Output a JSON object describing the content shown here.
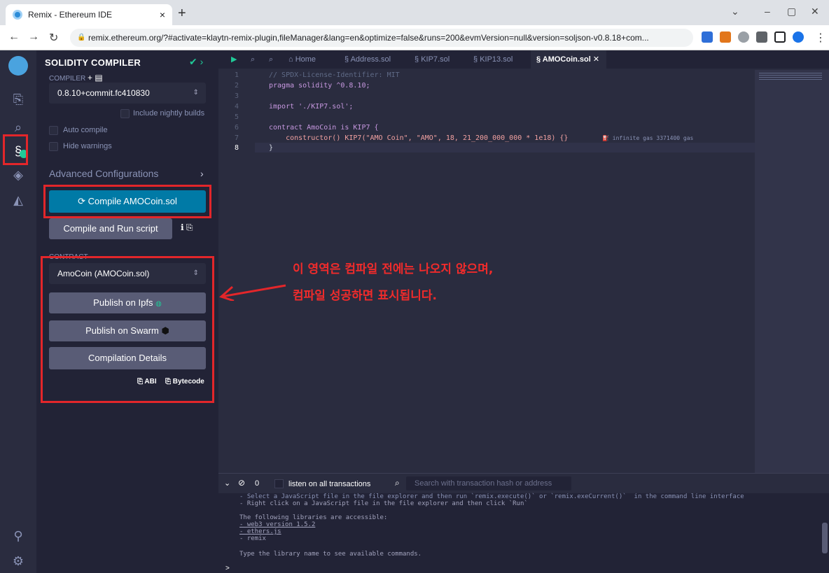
{
  "browser": {
    "tab_title": "Remix - Ethereum IDE",
    "tab_close": "×",
    "new_tab": "+",
    "url": "remix.ethereum.org/?#activate=klaytn-remix-plugin,fileManager&lang=en&optimize=false&runs=200&evmVersion=null&version=soljson-v0.8.18+com..."
  },
  "side_panel": {
    "title": "SOLIDITY COMPILER",
    "compiler_label": "COMPILER",
    "compiler_version": "0.8.10+commit.fc410830",
    "include_nightly": "Include nightly builds",
    "auto_compile": "Auto compile",
    "hide_warnings": "Hide warnings",
    "advanced": "Advanced Configurations",
    "compile_button": "Compile AMOCoin.sol",
    "compile_run_button": "Compile and Run script",
    "contract_label": "CONTRACT",
    "contract_select": "AmoCoin (AMOCoin.sol)",
    "publish_ipfs": "Publish on Ipfs",
    "publish_swarm": "Publish on Swarm",
    "compilation_details": "Compilation Details",
    "abi": "ABI",
    "bytecode": "Bytecode"
  },
  "editor": {
    "tabs": [
      "Home",
      "Address.sol",
      "KIP7.sol",
      "KIP13.sol",
      "AMOCoin.sol"
    ],
    "lines": [
      {
        "n": "1",
        "text": "// SPDX-License-Identifier: MIT"
      },
      {
        "n": "2",
        "text": "pragma solidity ^0.8.10;"
      },
      {
        "n": "3",
        "text": ""
      },
      {
        "n": "4",
        "text": "import './KIP7.sol';"
      },
      {
        "n": "5",
        "text": ""
      },
      {
        "n": "6",
        "text": "contract AmoCoin is KIP7 {"
      },
      {
        "n": "7",
        "text": "    constructor() KIP7(\"AMO Coin\", \"AMO\", 18, 21_200_000_000 * 1e18) {}"
      },
      {
        "n": "8",
        "text": "}"
      }
    ],
    "gas_hint": "infinite gas 3371400 gas"
  },
  "terminal": {
    "count": "0",
    "listen_label": "listen on all transactions",
    "search_placeholder": "Search with transaction hash or address",
    "lines": [
      "- Select a JavaScript file in the file explorer and then run `remix.execute()` or `remix.exeCurrent()`  in the command line interface",
      "- Right click on a JavaScript file in the file explorer and then click `Run`",
      "",
      "The following libraries are accessible:",
      "- web3 version 1.5.2",
      "- ethers.js",
      "- remix",
      "",
      "Type the library name to see available commands."
    ],
    "prompt": ">"
  },
  "annotation": {
    "line1": "이 영역은 컴파일 전에는 나오지 않으며,",
    "line2": "컴파일 성공하면 표시됩니다."
  },
  "colors": {
    "accent": "#007aa6",
    "highlight": "#e3262a",
    "success": "#20c997"
  }
}
